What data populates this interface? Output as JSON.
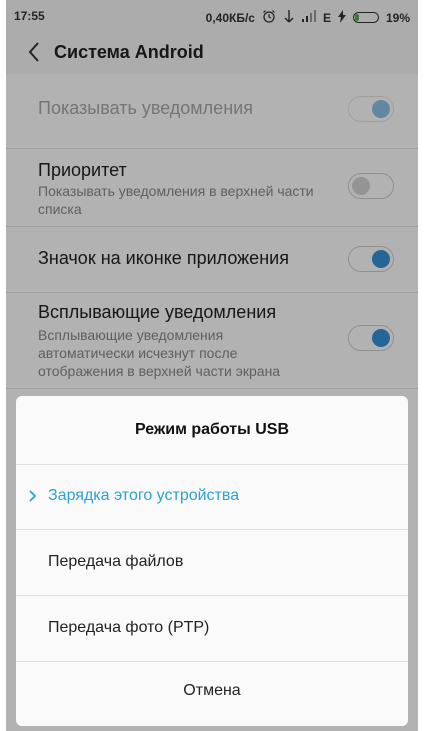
{
  "status_bar": {
    "time": "17:55",
    "speed": "0,40КБ/с",
    "network": "E",
    "battery": "19%",
    "icons": [
      "alarm-icon",
      "wifi-icon",
      "signal-icon",
      "charging-icon",
      "battery-icon"
    ]
  },
  "toolbar": {
    "title": "Система Android"
  },
  "settings": {
    "show_notifications": {
      "title": "Показывать уведомления",
      "enabled": true
    },
    "priority": {
      "title": "Приоритет",
      "subtitle": "Показывать уведомления в верхней части списка",
      "enabled": false
    },
    "app_icon_badge": {
      "title": "Значок на иконке приложения",
      "enabled": true
    },
    "popup": {
      "title": "Всплывающие уведомления",
      "subtitle": "Всплывающие уведомления автоматически исчезнут после отображения в верхней части экрана",
      "enabled": true
    }
  },
  "dialog": {
    "title": "Режим работы USB",
    "options": [
      {
        "label": "Зарядка этого устройства",
        "selected": true
      },
      {
        "label": "Передача файлов",
        "selected": false
      },
      {
        "label": "Передача фото (PTP)",
        "selected": false
      }
    ],
    "cancel": "Отмена"
  },
  "colors": {
    "accent": "#2aa1d8",
    "toggle_on": "#3492d6",
    "battery_fill": "#4caf50"
  }
}
